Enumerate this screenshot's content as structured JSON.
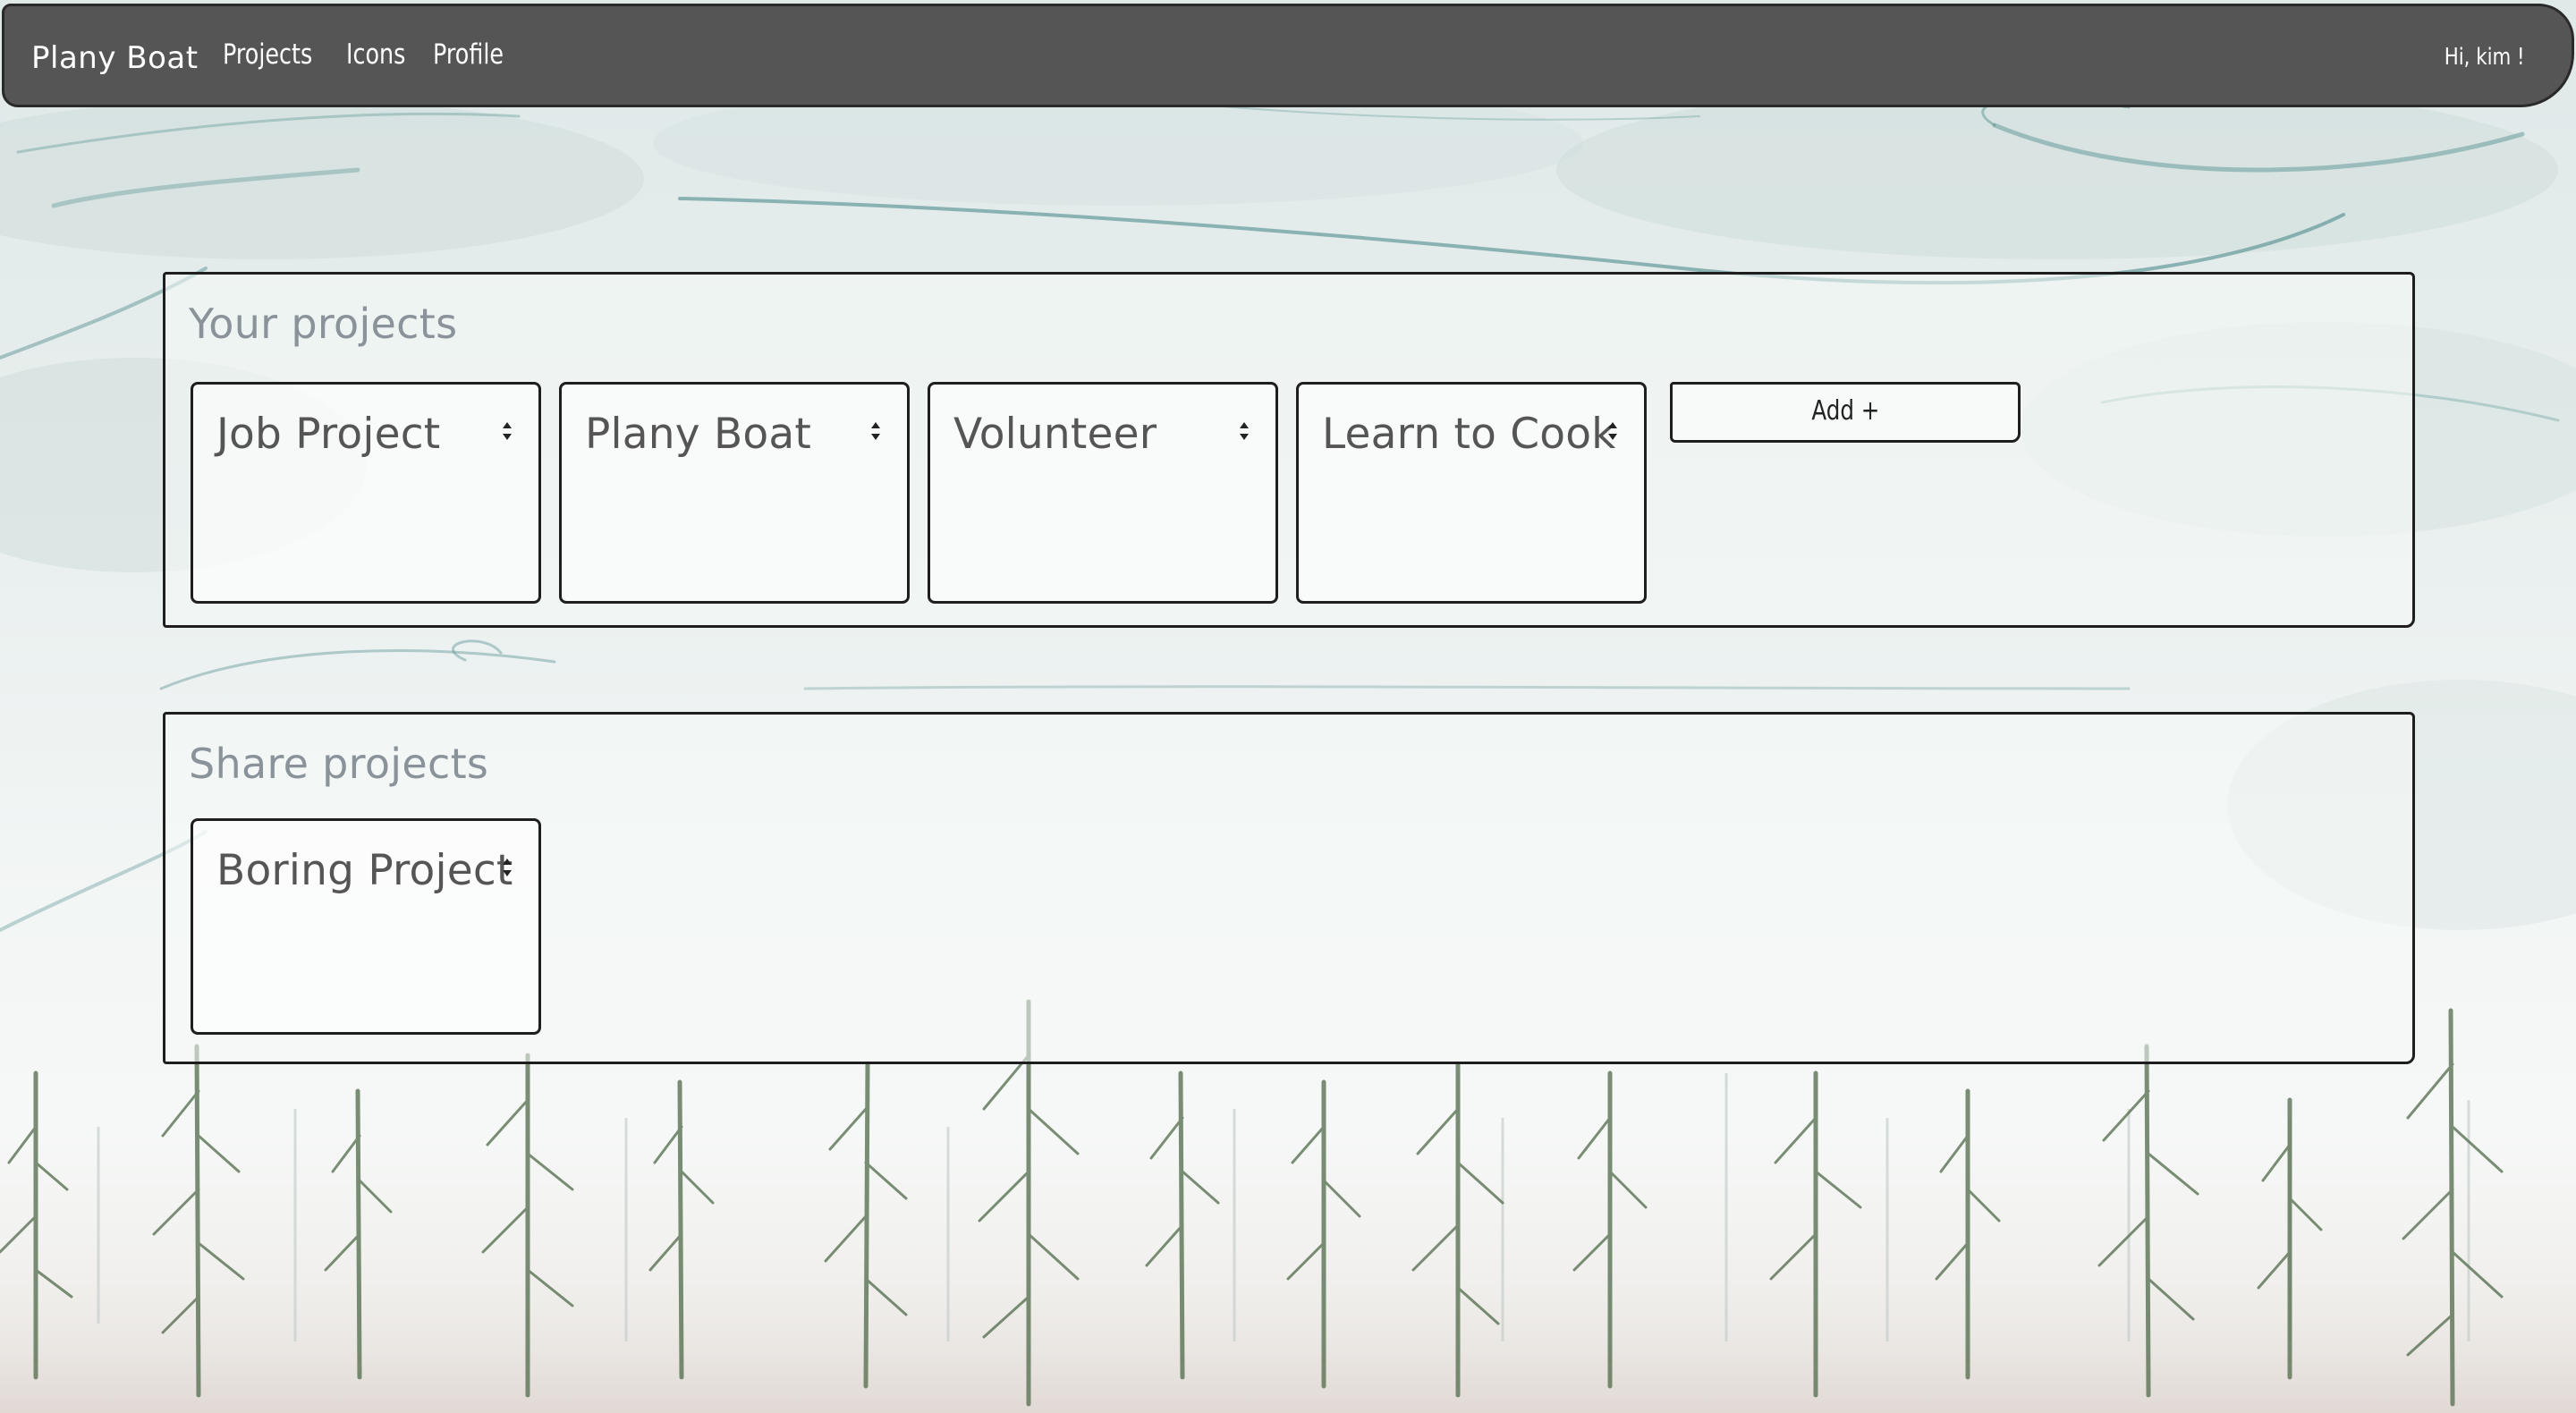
{
  "navbar": {
    "brand": "Plany Boat",
    "links": [
      "Projects",
      "Icons",
      "Profile"
    ],
    "greeting": "Hi, kim !"
  },
  "your_projects": {
    "title": "Your projects",
    "cards": [
      "Job Project",
      "Plany Boat",
      "Volunteer",
      "Learn to Cook"
    ],
    "add_label": "Add +"
  },
  "share_projects": {
    "title": "Share projects",
    "cards": [
      "Boring Project"
    ]
  },
  "colors": {
    "navbar": "#555555",
    "panel_title": "#8a929a",
    "card_title": "#555555",
    "border": "#1e1e1e"
  }
}
